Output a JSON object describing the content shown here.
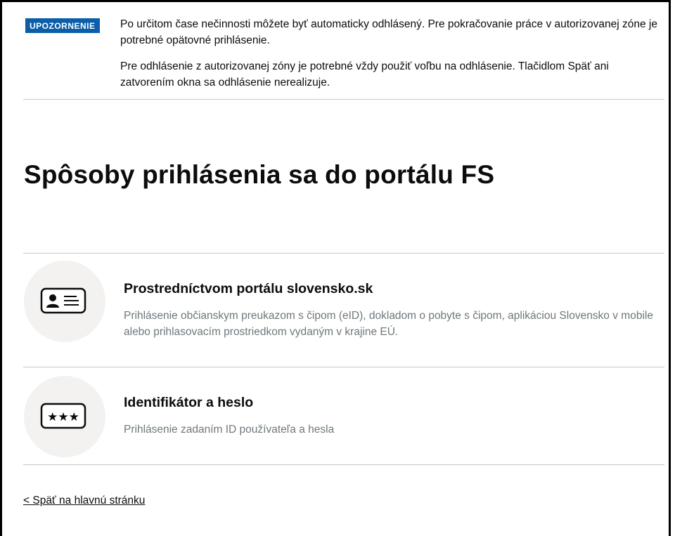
{
  "warning": {
    "tag": "UPOZORNENIE",
    "paragraph_1": "Po určitom čase nečinnosti môžete byť automaticky odhlásený. Pre pokračovanie práce v autorizovanej zóne je potrebné opätovné prihlásenie.",
    "paragraph_2": "Pre odhlásenie z autorizovanej zóny je potrebné vždy použiť voľbu na odhlásenie. Tlačidlom Späť ani zatvorením okna sa odhlásenie nerealizuje.",
    "tag_color": "#0b5ea9"
  },
  "page": {
    "title": "Spôsoby prihlásenia sa do portálu FS"
  },
  "options": [
    {
      "title": "Prostredníctvom portálu slovensko.sk",
      "description": "Prihlásenie občianskym preukazom s čipom (eID), dokladom o pobyte s čipom, aplikáciou Slovensko v mobile alebo prihlasovacím prostriedkom vydaným v krajine EÚ.",
      "icon": "id-card-icon"
    },
    {
      "title": "Identifikátor a heslo",
      "description": "Prihlásenie zadaním ID používateľa a hesla",
      "icon": "password-field-icon"
    }
  ],
  "back_link": {
    "label": "< Späť na hlavnú stránku"
  }
}
